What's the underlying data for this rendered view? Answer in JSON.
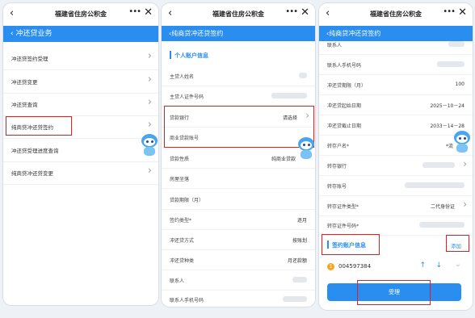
{
  "app_title": "福建省住房公积金",
  "icons": {
    "back": "chevron-left-icon",
    "more": "more-dots-icon",
    "close": "close-icon",
    "chevron": "chevron-right-icon"
  },
  "colors": {
    "primary": "#2a8ef0",
    "highlight": "#e02020",
    "warning": "#f5a623"
  },
  "screen1": {
    "header": "冲还贷业务",
    "menu": [
      "冲还贷签约受理",
      "冲还贷变更",
      "冲还贷查询",
      "纯商贷冲还贷签约",
      "冲还贷受理进度查询",
      "纯商贷冲还贷变更"
    ]
  },
  "screen2": {
    "header": "纯商贷冲还贷签约",
    "section_title": "个人账户信息",
    "fields": [
      {
        "label": "主贷人姓名",
        "value": ""
      },
      {
        "label": "主贷人证件号码",
        "value": ""
      },
      {
        "label": "贷款银行",
        "value": "请选择"
      },
      {
        "label": "商业贷款账号",
        "value": ""
      },
      {
        "label": "贷款性质",
        "value": "纯商业贷款"
      },
      {
        "label": "房屋坐落",
        "value": ""
      },
      {
        "label": "贷款期限（月）",
        "value": ""
      },
      {
        "label": "签约类型*",
        "value": "逐月"
      },
      {
        "label": "冲还贷方式",
        "value": "按账划"
      },
      {
        "label": "冲还贷种类",
        "value": "月还款额"
      },
      {
        "label": "联系人",
        "value": ""
      },
      {
        "label": "联系人手机号码",
        "value": ""
      }
    ]
  },
  "screen3": {
    "header": "纯商贷冲还贷签约",
    "fields": [
      {
        "label": "联系人",
        "value": ""
      },
      {
        "label": "联系人手机号码",
        "value": ""
      },
      {
        "label": "冲还贷期限（月）",
        "value": "100"
      },
      {
        "label": "冲还贷起始日期",
        "value": "2025－10－24"
      },
      {
        "label": "冲还贷截止日期",
        "value": "2033－14－28"
      },
      {
        "label": "转存户名*",
        "value": "*流"
      },
      {
        "label": "转存银行",
        "value": ""
      },
      {
        "label": "转存账号",
        "value": ""
      },
      {
        "label": "转存证件类型*",
        "value": "二代身份证"
      },
      {
        "label": "转存证件号码*",
        "value": ""
      }
    ],
    "section_title": "签约账户信息",
    "add_label": "添加",
    "account": {
      "index": "1",
      "number": "004597384"
    },
    "submit_label": "受理"
  }
}
